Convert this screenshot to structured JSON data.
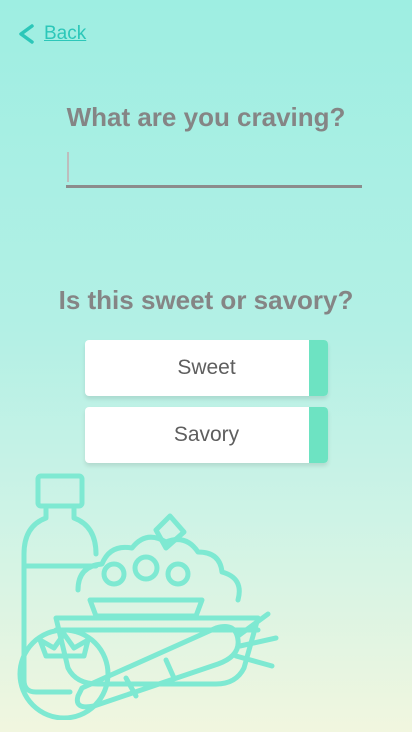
{
  "header": {
    "back_label": "Back"
  },
  "craving": {
    "question": "What are you craving?",
    "value": ""
  },
  "taste": {
    "question": "Is this sweet or savory?",
    "options": [
      "Sweet",
      "Savory"
    ]
  },
  "colors": {
    "accent": "#2cc7b9",
    "option_tab": "#6de3c2",
    "illustration": "#7ee9d2"
  }
}
